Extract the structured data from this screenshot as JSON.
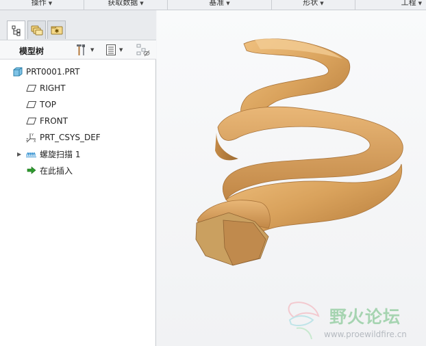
{
  "ribbon": {
    "groups": [
      {
        "label": "操作"
      },
      {
        "label": "获取数据"
      },
      {
        "label": "基准"
      },
      {
        "label": "形状"
      },
      {
        "label": "工程"
      }
    ]
  },
  "navigator": {
    "tabs": [
      {
        "name": "model-tree-tab",
        "icon": "model-tree-icon",
        "active": true
      },
      {
        "name": "folder-browser-tab",
        "icon": "folder-browser-icon",
        "active": false
      },
      {
        "name": "favorites-tab",
        "icon": "favorites-icon",
        "active": false
      }
    ],
    "title": "模型树",
    "tree": [
      {
        "label": "PRT0001.PRT",
        "icon": "part-icon"
      },
      {
        "label": "RIGHT",
        "icon": "datum-plane-icon"
      },
      {
        "label": "TOP",
        "icon": "datum-plane-icon"
      },
      {
        "label": "FRONT",
        "icon": "datum-plane-icon"
      },
      {
        "label": "PRT_CSYS_DEF",
        "icon": "csys-icon"
      },
      {
        "label": "螺旋扫描 1",
        "icon": "helical-sweep-icon",
        "expandable": true
      },
      {
        "label": "在此插入",
        "icon": "insert-here-arrow-icon"
      }
    ]
  },
  "graphics": {
    "model": "helical-sweep-3d-model",
    "color": "#d9a25c"
  },
  "watermark": {
    "name": "野火论坛",
    "url": "www.proewildfire.cn"
  }
}
